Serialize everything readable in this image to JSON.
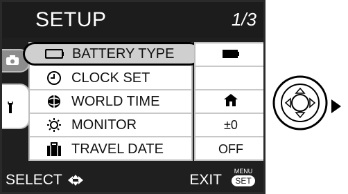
{
  "header": {
    "title": "SETUP",
    "page": "1/3"
  },
  "menu": {
    "items": [
      {
        "label": "BATTERY TYPE",
        "icon": "battery-icon"
      },
      {
        "label": "CLOCK SET",
        "icon": "clock-icon"
      },
      {
        "label": "WORLD TIME",
        "icon": "globe-icon"
      },
      {
        "label": "MONITOR",
        "icon": "sun-icon"
      },
      {
        "label": "TRAVEL DATE",
        "icon": "luggage-icon"
      }
    ],
    "selected_index": 0
  },
  "values": [
    {
      "text": "",
      "icon": "battery-icon"
    },
    {
      "text": "",
      "icon": ""
    },
    {
      "text": "",
      "icon": "home-icon"
    },
    {
      "text": "±0",
      "icon": ""
    },
    {
      "text": "OFF",
      "icon": ""
    }
  ],
  "footer": {
    "select_label": "SELECT",
    "exit_label": "EXIT",
    "menu_label": "MENU",
    "set_label": "SET"
  },
  "colors": {
    "screen_bg": "#1f1f1f",
    "tab_bg": "#8d8d8d",
    "selected_row": "#cfcfcf"
  }
}
